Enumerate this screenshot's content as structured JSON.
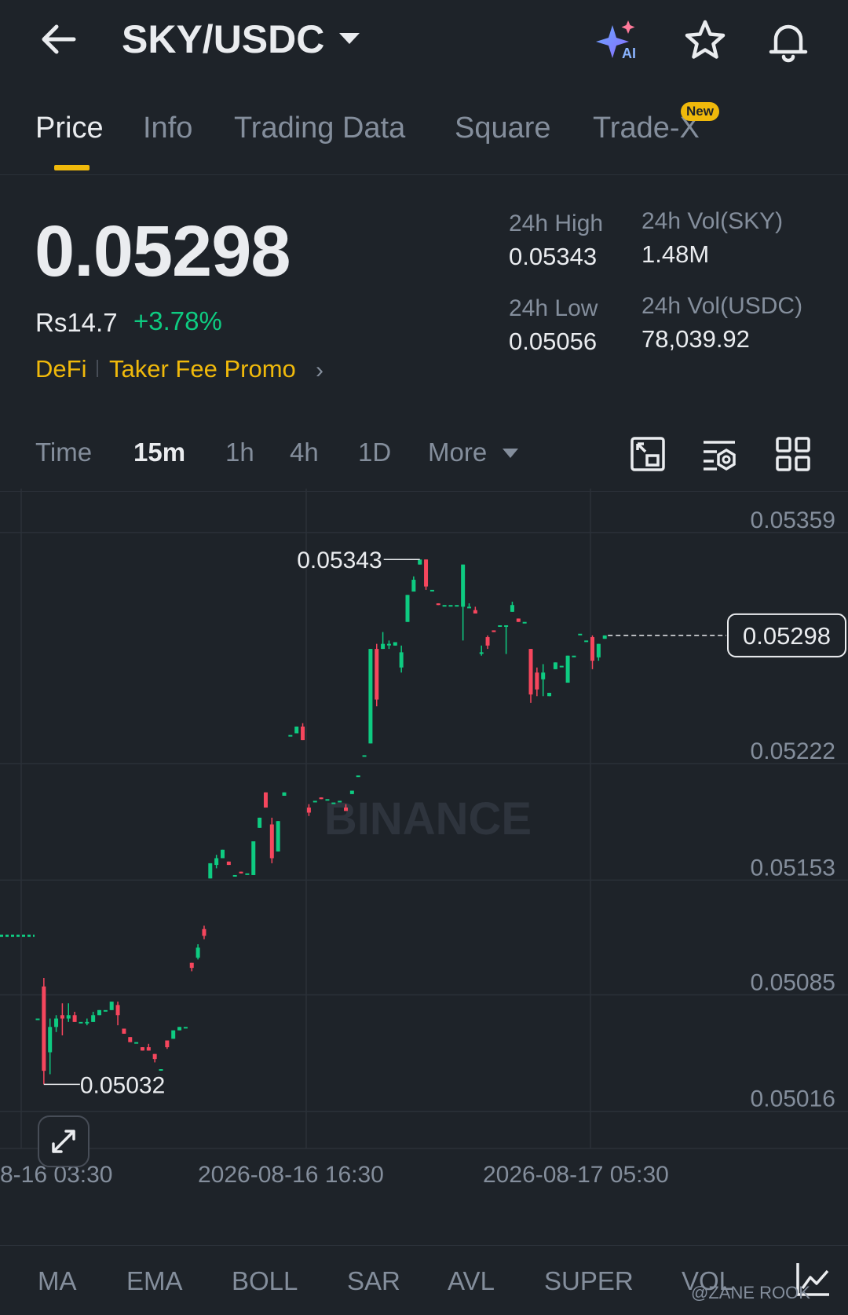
{
  "header": {
    "pair": "SKY/USDC",
    "icons": [
      "back-arrow-icon",
      "ai-sparkle-icon",
      "star-icon",
      "bell-icon"
    ],
    "ai_label": "AI"
  },
  "tabs": [
    {
      "label": "Price",
      "active": true
    },
    {
      "label": "Info"
    },
    {
      "label": "Trading Data"
    },
    {
      "label": "Square"
    },
    {
      "label": "Trade-X"
    }
  ],
  "new_badge": "New",
  "ticker": {
    "price": "0.05298",
    "fiat": "Rs14.7",
    "change": "+3.78%",
    "tag1": "DeFi",
    "tag2": "Taker Fee Promo",
    "high_label": "24h High",
    "high": "0.05343",
    "low_label": "24h Low",
    "low": "0.05056",
    "vol_base_label": "24h Vol(SKY)",
    "vol_base": "1.48M",
    "vol_quote_label": "24h Vol(USDC)",
    "vol_quote": "78,039.92"
  },
  "intervals": {
    "items": [
      "Time",
      "15m",
      "1h",
      "4h",
      "1D"
    ],
    "active": "15m",
    "more": "More"
  },
  "chart_data": {
    "type": "candlestick",
    "y_ticks": [
      "0.05359",
      "0.05222",
      "0.05153",
      "0.05085",
      "0.05016"
    ],
    "x_ticks": [
      "8-16 03:30",
      "2026-08-16 16:30",
      "2026-08-17 05:30"
    ],
    "ylim": [
      0.04994,
      0.05385
    ],
    "high_marker": "0.05343",
    "low_marker": "0.05032",
    "last_price": "0.05298",
    "watermark": "BINANCE",
    "colors": {
      "up": "#0ecb81",
      "down": "#f6465d",
      "grid": "#2b3139"
    },
    "candles": [
      [
        0.05071,
        0.05071,
        0.05071,
        0.05071
      ],
      [
        0.0509,
        0.0504,
        0.05032,
        0.05095
      ],
      [
        0.05051,
        0.05066,
        0.05038,
        0.05071
      ],
      [
        0.05066,
        0.05071,
        0.05063,
        0.05073
      ],
      [
        0.05073,
        0.05071,
        0.05061,
        0.0508
      ],
      [
        0.05071,
        0.05073,
        0.05069,
        0.0508
      ],
      [
        0.05073,
        0.05069,
        0.05069,
        0.05075
      ],
      [
        0.05069,
        0.05069,
        0.05069,
        0.05069
      ],
      [
        0.05069,
        0.05069,
        0.05067,
        0.05071
      ],
      [
        0.05069,
        0.05073,
        0.05069,
        0.05075
      ],
      [
        0.05073,
        0.05076,
        0.05073,
        0.05076
      ],
      [
        0.05076,
        0.05076,
        0.05076,
        0.05076
      ],
      [
        0.05076,
        0.05081,
        0.05076,
        0.05081
      ],
      [
        0.05079,
        0.05073,
        0.05067,
        0.05081
      ],
      [
        0.05065,
        0.05062,
        0.05062,
        0.05065
      ],
      [
        0.0506,
        0.05057,
        0.05057,
        0.0506
      ],
      [
        0.05057,
        0.05057,
        0.05057,
        0.05057
      ],
      [
        0.05054,
        0.05052,
        0.05052,
        0.05054
      ],
      [
        0.05054,
        0.05052,
        0.05052,
        0.05056
      ],
      [
        0.0505,
        0.05047,
        0.05045,
        0.0505
      ],
      [
        0.05041,
        0.05041,
        0.05041,
        0.05041
      ],
      [
        0.05058,
        0.05054,
        0.05053,
        0.05058
      ],
      [
        0.05059,
        0.05064,
        0.05059,
        0.05064
      ],
      [
        0.05064,
        0.05066,
        0.05064,
        0.05066
      ],
      [
        0.05066,
        0.05066,
        0.05066,
        0.05066
      ],
      [
        0.05104,
        0.05101,
        0.05099,
        0.05104
      ],
      [
        0.05107,
        0.05113,
        0.05106,
        0.05115
      ],
      [
        0.05124,
        0.0512,
        0.05118,
        0.05126
      ],
      [
        0.05154,
        0.05163,
        0.05154,
        0.05163
      ],
      [
        0.05162,
        0.05166,
        0.0516,
        0.05168
      ],
      [
        0.05166,
        0.05171,
        0.05166,
        0.05171
      ],
      [
        0.05164,
        0.05162,
        0.05162,
        0.05164
      ],
      [
        0.05156,
        0.05156,
        0.05156,
        0.05156
      ],
      [
        0.05158,
        0.05157,
        0.05157,
        0.05158
      ],
      [
        0.05157,
        0.05157,
        0.05157,
        0.05157
      ],
      [
        0.05156,
        0.05176,
        0.05156,
        0.05176
      ],
      [
        0.05184,
        0.0519,
        0.05184,
        0.0519
      ],
      [
        0.05205,
        0.05196,
        0.05196,
        0.05205
      ],
      [
        0.05186,
        0.05166,
        0.05163,
        0.0519
      ],
      [
        0.0517,
        0.05188,
        0.0517,
        0.05188
      ],
      [
        0.05203,
        0.05205,
        0.05203,
        0.05205
      ],
      [
        0.05239,
        0.05239,
        0.05239,
        0.05239
      ],
      [
        0.0524,
        0.05244,
        0.0524,
        0.05244
      ],
      [
        0.05244,
        0.05236,
        0.05236,
        0.05246
      ],
      [
        0.05196,
        0.05193,
        0.05191,
        0.05198
      ],
      [
        0.052,
        0.052,
        0.052,
        0.052
      ],
      [
        0.05202,
        0.05201,
        0.05201,
        0.05202
      ],
      [
        0.05201,
        0.05201,
        0.05201,
        0.05201
      ],
      [
        0.05199,
        0.05199,
        0.05199,
        0.05199
      ],
      [
        0.052,
        0.052,
        0.052,
        0.052
      ],
      [
        0.05196,
        0.05194,
        0.05194,
        0.05198
      ],
      [
        0.05204,
        0.05206,
        0.05204,
        0.05206
      ],
      [
        0.05215,
        0.05215,
        0.05215,
        0.05215
      ],
      [
        0.05227,
        0.05227,
        0.05227,
        0.05227
      ],
      [
        0.05234,
        0.0529,
        0.05234,
        0.0529
      ],
      [
        0.0529,
        0.0526,
        0.05256,
        0.05293
      ],
      [
        0.0529,
        0.05293,
        0.0529,
        0.053
      ],
      [
        0.05293,
        0.05293,
        0.0529,
        0.05295
      ],
      [
        0.05292,
        0.05294,
        0.05292,
        0.05294
      ],
      [
        0.05279,
        0.05288,
        0.05276,
        0.05292
      ],
      [
        0.05306,
        0.05322,
        0.05306,
        0.05322
      ],
      [
        0.05324,
        0.05331,
        0.05324,
        0.05333
      ],
      [
        0.0534,
        0.05343,
        0.0534,
        0.05343
      ],
      [
        0.05343,
        0.05327,
        0.05325,
        0.05343
      ],
      [
        0.05325,
        0.05325,
        0.05325,
        0.05325
      ],
      [
        0.05317,
        0.05316,
        0.05316,
        0.05317
      ],
      [
        0.05316,
        0.05316,
        0.05316,
        0.05316
      ],
      [
        0.05316,
        0.05316,
        0.05316,
        0.05316
      ],
      [
        0.05316,
        0.05316,
        0.05316,
        0.05316
      ],
      [
        0.05315,
        0.0534,
        0.05295,
        0.0534
      ],
      [
        0.05315,
        0.05315,
        0.05315,
        0.05317
      ],
      [
        0.05313,
        0.05311,
        0.05311,
        0.05315
      ],
      [
        0.05288,
        0.05288,
        0.05286,
        0.05292
      ],
      [
        0.05297,
        0.05292,
        0.0529,
        0.05298
      ],
      [
        0.05301,
        0.053,
        0.053,
        0.05301
      ],
      [
        0.05304,
        0.05304,
        0.05304,
        0.05304
      ],
      [
        0.05304,
        0.05304,
        0.05287,
        0.05304
      ],
      [
        0.05312,
        0.05316,
        0.05312,
        0.05318
      ],
      [
        0.05308,
        0.05306,
        0.05306,
        0.05308
      ],
      [
        0.05306,
        0.05306,
        0.05306,
        0.05306
      ],
      [
        0.0529,
        0.05263,
        0.05258,
        0.0529
      ],
      [
        0.05276,
        0.05266,
        0.05262,
        0.05279
      ],
      [
        0.05272,
        0.05276,
        0.05262,
        0.05281
      ],
      [
        0.05262,
        0.05264,
        0.05262,
        0.05264
      ],
      [
        0.05278,
        0.05282,
        0.05278,
        0.05282
      ],
      [
        0.0528,
        0.0528,
        0.0528,
        0.0528
      ],
      [
        0.0527,
        0.05286,
        0.0527,
        0.05286
      ],
      [
        0.05286,
        0.05286,
        0.05286,
        0.05286
      ],
      [
        0.05299,
        0.05299,
        0.05299,
        0.05299
      ],
      [
        0.05295,
        0.05295,
        0.05295,
        0.05295
      ],
      [
        0.05297,
        0.05283,
        0.05278,
        0.05298
      ],
      [
        0.05285,
        0.05293,
        0.05283,
        0.05293
      ],
      [
        0.05296,
        0.05298,
        0.05296,
        0.05298
      ]
    ]
  },
  "indicators": [
    "MA",
    "EMA",
    "BOLL",
    "SAR",
    "AVL",
    "SUPER",
    "VOL"
  ],
  "watermark_user": "@ZANE ROOK"
}
